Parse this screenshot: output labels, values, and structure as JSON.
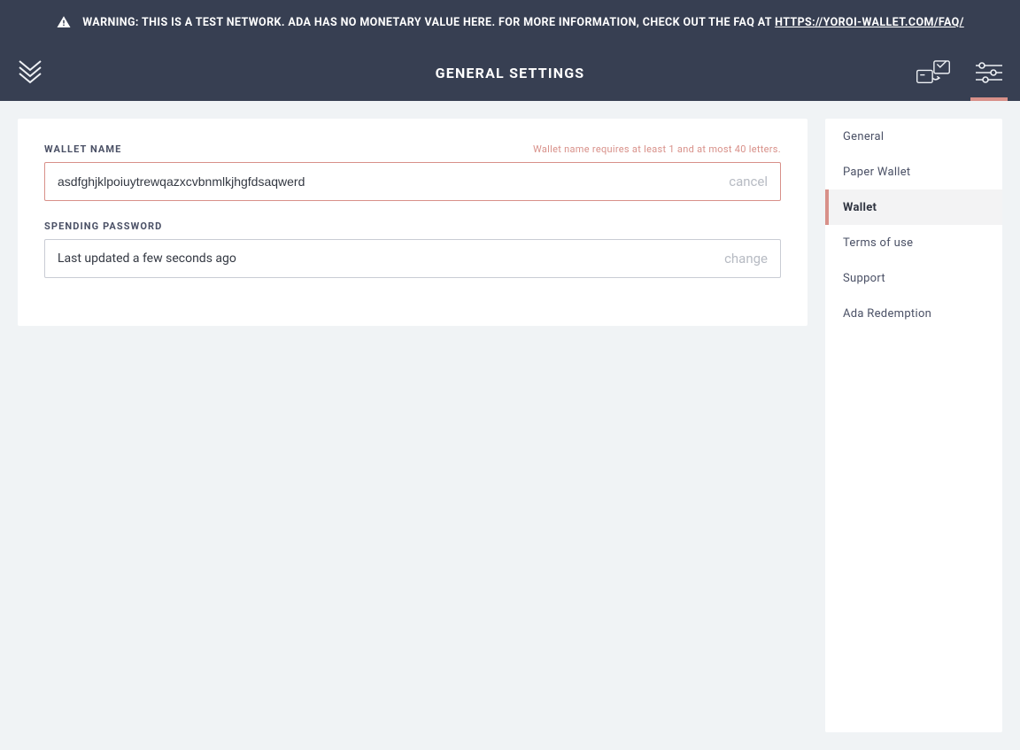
{
  "banner": {
    "text_prefix": "WARNING: THIS IS A TEST NETWORK. ADA HAS NO MONETARY VALUE HERE. FOR MORE INFORMATION, CHECK OUT THE FAQ AT ",
    "link_text": "HTTPS://YOROI-WALLET.COM/FAQ/"
  },
  "header": {
    "title": "GENERAL SETTINGS"
  },
  "walletName": {
    "label": "WALLET NAME",
    "error": "Wallet name requires at least 1 and at most 40 letters.",
    "value": "asdfghjklpoiuytrewqazxcvbnmlkjhgfdsaqwerd",
    "action": "cancel"
  },
  "spendingPassword": {
    "label": "SPENDING PASSWORD",
    "status": "Last updated a few seconds ago",
    "action": "change"
  },
  "sidebar": {
    "items": [
      {
        "label": "General"
      },
      {
        "label": "Paper Wallet"
      },
      {
        "label": "Wallet"
      },
      {
        "label": "Terms of use"
      },
      {
        "label": "Support"
      },
      {
        "label": "Ada Redemption"
      }
    ],
    "activeIndex": 2
  }
}
